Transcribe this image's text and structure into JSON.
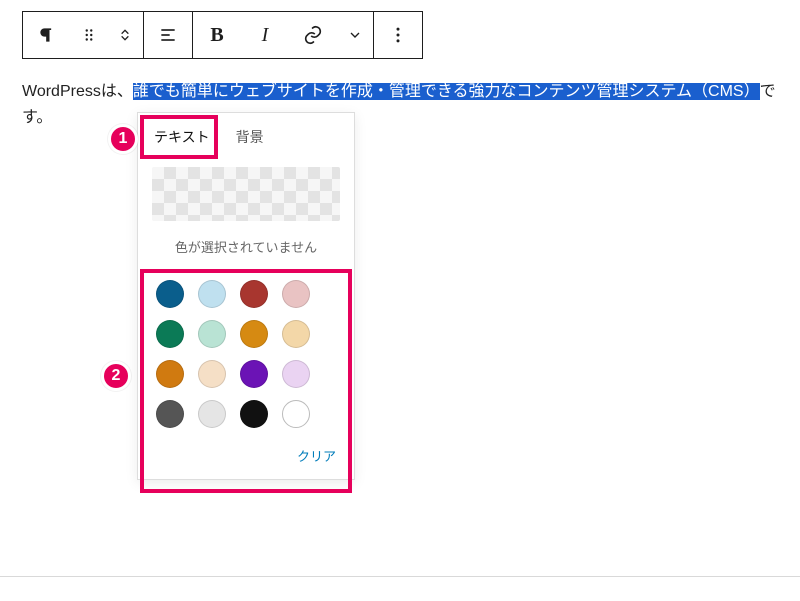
{
  "toolbar": {
    "paragraph_icon": "pilcrow",
    "drag_icon": "drag-handle",
    "move_icon": "chevrons-vertical",
    "align_icon": "align-left",
    "bold_label": "B",
    "italic_label": "I",
    "link_icon": "link",
    "more_rich_icon": "chevron-down",
    "options_icon": "more-vertical"
  },
  "content": {
    "before": "WordPressは、",
    "highlighted": "誰でも簡単にウェブサイトを作成・管理できる強力なコンテンツ管理システム（CMS）",
    "after": "です。"
  },
  "popover": {
    "tabs": {
      "text": "テキスト",
      "background": "背景"
    },
    "no_color_message": "色が選択されていません",
    "clear_label": "クリア",
    "swatches": [
      "#0a5e8c",
      "#bfe0ef",
      "#a8362f",
      "#e9c3c3",
      "#0b7a56",
      "#b9e3d4",
      "#d68a12",
      "#f3d7a8",
      "#d07a10",
      "#f5dfc6",
      "#6b13b5",
      "#ead3f2",
      "#555555",
      "#e5e5e5",
      "#111111"
    ]
  },
  "callouts": {
    "one": "1",
    "two": "2"
  }
}
